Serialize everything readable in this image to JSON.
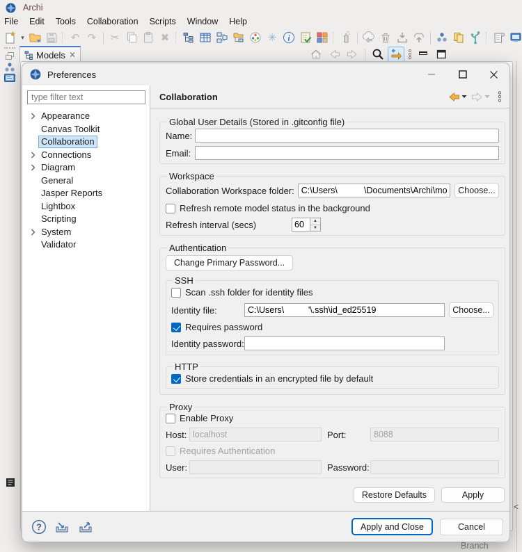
{
  "app": {
    "title": "Archi"
  },
  "menu": {
    "items": [
      "File",
      "Edit",
      "Tools",
      "Collaboration",
      "Scripts",
      "Window",
      "Help"
    ]
  },
  "icons": {
    "dropdown": "▾",
    "undo": "↶",
    "redo": "↷",
    "cut": "✂",
    "delete": "✖",
    "sparkle": "✳",
    "collapse": "<"
  },
  "tab": {
    "label": "Models"
  },
  "background": {
    "branch_label": "Branch"
  },
  "dialog": {
    "title": "Preferences",
    "filter_placeholder": "type filter text",
    "tree": [
      {
        "label": "Appearance",
        "expandable": true,
        "selected": false
      },
      {
        "label": "Canvas Toolkit",
        "expandable": false,
        "selected": false
      },
      {
        "label": "Collaboration",
        "expandable": false,
        "selected": true
      },
      {
        "label": "Connections",
        "expandable": true,
        "selected": false
      },
      {
        "label": "Diagram",
        "expandable": true,
        "selected": false
      },
      {
        "label": "General",
        "expandable": false,
        "selected": false
      },
      {
        "label": "Jasper Reports",
        "expandable": false,
        "selected": false
      },
      {
        "label": "Lightbox",
        "expandable": false,
        "selected": false
      },
      {
        "label": "Scripting",
        "expandable": false,
        "selected": false
      },
      {
        "label": "System",
        "expandable": true,
        "selected": false
      },
      {
        "label": "Validator",
        "expandable": false,
        "selected": false
      }
    ],
    "page_title": "Collaboration",
    "user_group": {
      "legend": "Global User Details (Stored in .gitconfig file)",
      "name_label": "Name:",
      "email_label": "Email:"
    },
    "workspace_group": {
      "legend": "Workspace",
      "folder_label": "Collaboration Workspace folder:",
      "folder_value": "C:\\Users\\           \\Documents\\Archi\\model-re",
      "choose_label": "Choose...",
      "refresh_checkbox": "Refresh remote model status in the background",
      "interval_label": "Refresh interval (secs)",
      "interval_value": "60"
    },
    "auth_group": {
      "legend": "Authentication",
      "change_password_label": "Change Primary Password...",
      "ssh_legend": "SSH",
      "scan_checkbox": "Scan .ssh folder for identity files",
      "identity_file_label": "Identity file:",
      "identity_file_value": "C:\\Users\\          '\\.ssh\\id_ed25519",
      "choose_label": "Choose...",
      "requires_password_checkbox": "Requires password",
      "identity_password_label": "Identity password:",
      "http_legend": "HTTP",
      "store_checkbox": "Store credentials in an encrypted file by default"
    },
    "proxy_group": {
      "legend": "Proxy",
      "enable_checkbox": "Enable Proxy",
      "host_label": "Host:",
      "host_value": "localhost",
      "port_label": "Port:",
      "port_value": "8088",
      "requires_auth_checkbox": "Requires Authentication",
      "user_label": "User:",
      "password_label": "Password:"
    },
    "buttons": {
      "restore": "Restore Defaults",
      "apply": "Apply",
      "apply_close": "Apply and Close",
      "cancel": "Cancel"
    }
  }
}
